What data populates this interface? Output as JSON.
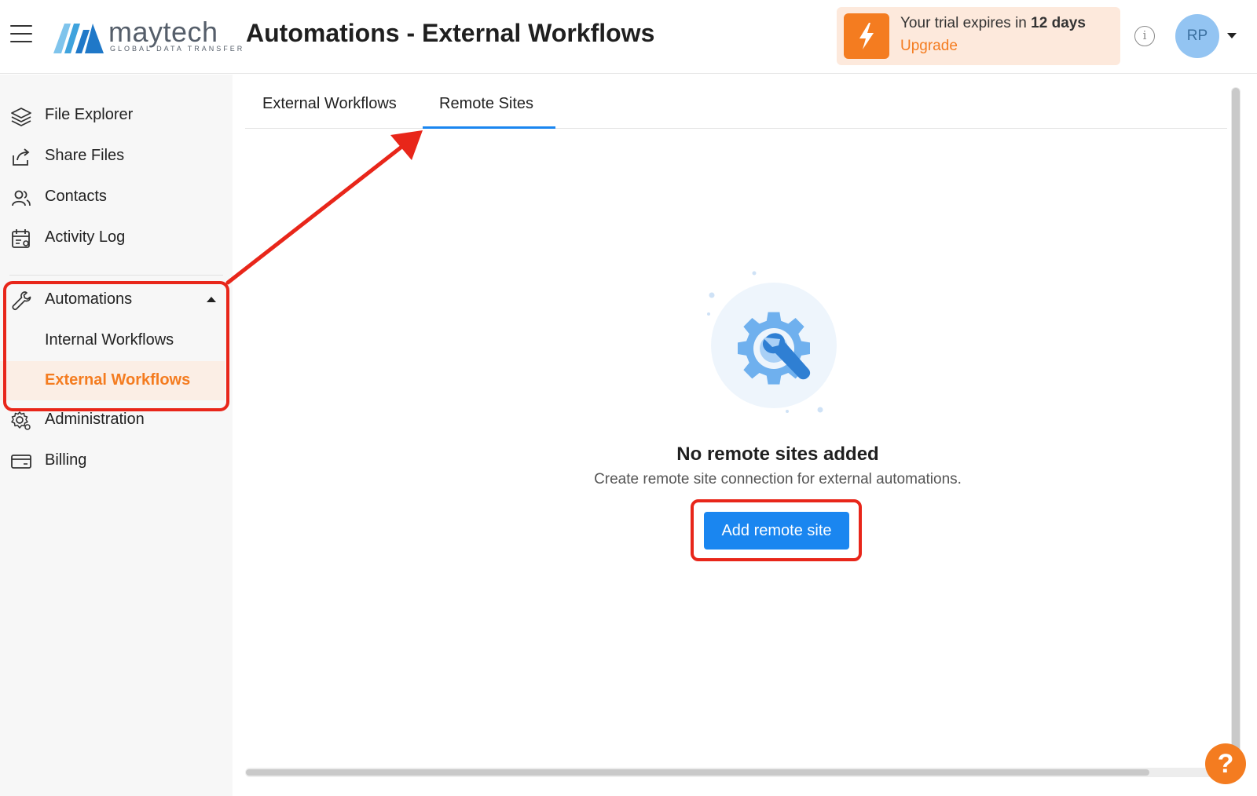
{
  "header": {
    "title": "Automations - External Workflows",
    "logo": {
      "word": "maytech",
      "tagline": "GLOBAL DATA TRANSFER"
    },
    "trial": {
      "prefix": "Your trial expires in ",
      "days": "12 days",
      "upgrade_label": "Upgrade"
    },
    "avatar_initials": "RP",
    "info_glyph": "i"
  },
  "sidebar": {
    "items": [
      {
        "label": "File Explorer",
        "icon": "layers-icon"
      },
      {
        "label": "Share Files",
        "icon": "share-icon"
      },
      {
        "label": "Contacts",
        "icon": "contacts-icon"
      },
      {
        "label": "Activity Log",
        "icon": "activity-log-icon"
      },
      {
        "label": "Automations",
        "icon": "wrench-icon"
      },
      {
        "label": "Administration",
        "icon": "gear-icon"
      },
      {
        "label": "Billing",
        "icon": "card-icon"
      }
    ],
    "automations_sub": [
      {
        "label": "Internal Workflows"
      },
      {
        "label": "External Workflows",
        "active": true
      }
    ]
  },
  "main": {
    "tabs": [
      {
        "label": "External Workflows"
      },
      {
        "label": "Remote Sites",
        "active": true
      }
    ],
    "empty_state": {
      "title": "No remote sites added",
      "description": "Create remote site connection for external automations.",
      "button_label": "Add remote site"
    }
  },
  "help_glyph": "?",
  "colors": {
    "accent_orange": "#f47c20",
    "primary_blue": "#1a86f0",
    "annotation_red": "#e8261a",
    "trial_bg": "#fde9dc"
  }
}
